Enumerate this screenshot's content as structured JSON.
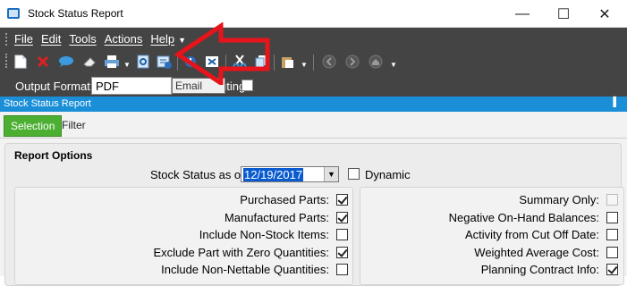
{
  "window": {
    "title": "Stock Status Report",
    "minimize": "—",
    "maximize": "☐",
    "close": "✕"
  },
  "menu": [
    "File",
    "Edit",
    "Tools",
    "Actions",
    "Help"
  ],
  "toolbar_icons": [
    "new-icon",
    "delete-icon",
    "chat-icon",
    "clear-icon",
    "print-icon",
    "print-preview-icon",
    "email-icon",
    "schedule-icon",
    "export-icon",
    "cut-icon",
    "copy-icon",
    "paste-icon",
    "back-icon",
    "forward-icon",
    "home-icon"
  ],
  "output": {
    "label": "Output Format:",
    "value": "PDF",
    "tooltip": "Email",
    "routing_label": "uting"
  },
  "panel": {
    "title": "Stock Status Report",
    "pin": "❘"
  },
  "tabs": {
    "selection": "Selection",
    "filter": "Filter"
  },
  "report_options": {
    "title": "Report Options",
    "date_label": "Stock Status as of:",
    "date_value": "12/19/2017",
    "dynamic_label": "Dynamic"
  },
  "left_options": [
    {
      "label": "Purchased Parts:",
      "checked": true
    },
    {
      "label": "Manufactured Parts:",
      "checked": true
    },
    {
      "label": "Include Non-Stock Items:",
      "checked": false
    },
    {
      "label": "Exclude Part with Zero Quantities:",
      "checked": true
    },
    {
      "label": "Include Non-Nettable Quantities:",
      "checked": false
    }
  ],
  "right_options": [
    {
      "label": "Summary Only:",
      "checked": false,
      "disabled": true
    },
    {
      "label": "Negative On-Hand Balances:",
      "checked": false
    },
    {
      "label": "Activity from Cut Off Date:",
      "checked": false
    },
    {
      "label": "Weighted Average Cost:",
      "checked": false
    },
    {
      "label": "Planning Contract Info:",
      "checked": true
    }
  ],
  "colors": {
    "toolbar_bg": "#444444",
    "panel_header": "#1a8fd8",
    "tab_selected": "#4caf32",
    "arrow": "#e8141b"
  }
}
